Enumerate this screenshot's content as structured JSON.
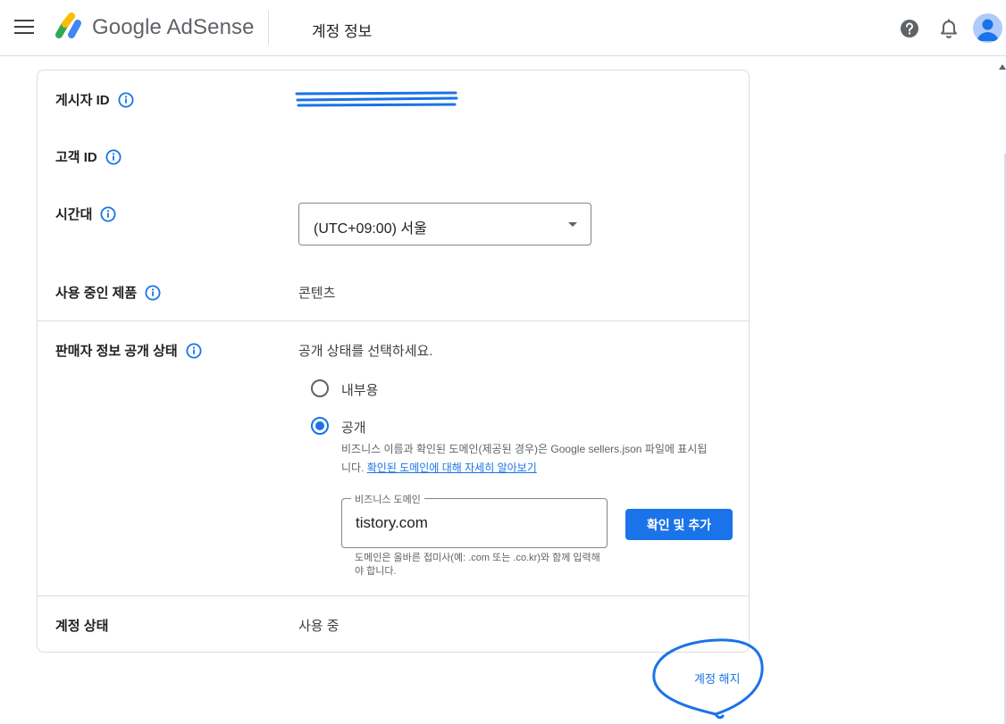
{
  "header": {
    "brand_google": "Google",
    "brand_product": "AdSense",
    "page_title": "계정 정보"
  },
  "account": {
    "publisher_id_label": "게시자 ID",
    "customer_id_label": "고객 ID",
    "timezone_label": "시간대",
    "timezone_value": "(UTC+09:00) 서울",
    "products_label": "사용 중인 제품",
    "products_value": "콘텐츠",
    "seller_visibility_label": "판매자 정보 공개 상태",
    "seller_visibility_prompt": "공개 상태를 선택하세요.",
    "radio_options": [
      {
        "label": "내부용",
        "selected": false
      },
      {
        "label": "공개",
        "selected": true
      }
    ],
    "public_description": "비즈니스 이름과 확인된 도메인(제공된 경우)은 Google sellers.json 파일에 표시됩니다.",
    "public_description_link": "확인된 도메인에 대해 자세히 알아보기",
    "domain_field_label": "비즈니스 도메인",
    "domain_field_value": "tistory.com",
    "domain_hint": "도메인은 올바른 접미사(예: .com 또는 .co.kr)와 함께 입력해야 합니다.",
    "confirm_button": "확인 및 추가",
    "status_label": "계정 상태",
    "status_value": "사용 중"
  },
  "footer": {
    "close_account_link": "계정 해지"
  },
  "colors": {
    "accent": "#1a73e8",
    "annotation": "#1a73e8",
    "divider": "#dadce0"
  }
}
